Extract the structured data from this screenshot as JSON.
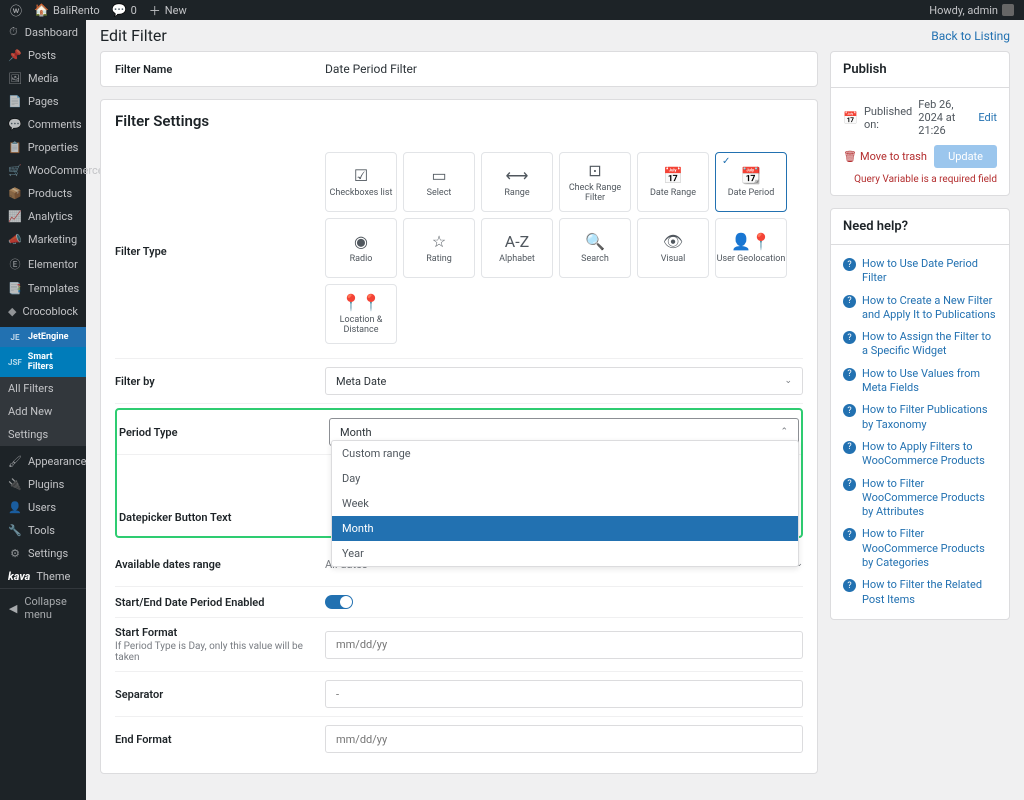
{
  "admin_bar": {
    "site_name": "BaliRento",
    "comments_count": "0",
    "new_label": "New",
    "howdy": "Howdy, admin"
  },
  "sidebar": {
    "items": [
      {
        "icon": "⏱",
        "label": "Dashboard"
      },
      {
        "icon": "📌",
        "label": "Posts"
      },
      {
        "icon": "🖼",
        "label": "Media"
      },
      {
        "icon": "📄",
        "label": "Pages"
      },
      {
        "icon": "💬",
        "label": "Comments"
      },
      {
        "icon": "📋",
        "label": "Properties"
      },
      {
        "icon": "🛒",
        "label": "WooCommerce"
      },
      {
        "icon": "📦",
        "label": "Products"
      },
      {
        "icon": "📈",
        "label": "Analytics"
      },
      {
        "icon": "📣",
        "label": "Marketing"
      },
      {
        "icon": "Ⓔ",
        "label": "Elementor"
      },
      {
        "icon": "📑",
        "label": "Templates"
      },
      {
        "icon": "◆",
        "label": "Crocoblock"
      }
    ],
    "jet_items": [
      {
        "abbr": "JE",
        "label": "JetEngine"
      },
      {
        "abbr": "JSF",
        "label": "Smart Filters"
      }
    ],
    "submenu": [
      "All Filters",
      "Add New",
      "Settings"
    ],
    "items2": [
      {
        "icon": "🖌",
        "label": "Appearance"
      },
      {
        "icon": "🔌",
        "label": "Plugins"
      },
      {
        "icon": "👤",
        "label": "Users"
      },
      {
        "icon": "🔧",
        "label": "Tools"
      },
      {
        "icon": "⚙",
        "label": "Settings"
      }
    ],
    "theme_label": "Theme",
    "collapse": "Collapse menu"
  },
  "header": {
    "title": "Edit Filter",
    "back": "Back to Listing"
  },
  "filter_name": {
    "label": "Filter Name",
    "value": "Date Period Filter"
  },
  "settings": {
    "title": "Filter Settings",
    "type_label": "Filter Type",
    "types": [
      {
        "icon": "☑",
        "label": "Checkboxes list"
      },
      {
        "icon": "▭",
        "label": "Select"
      },
      {
        "icon": "⟷",
        "label": "Range"
      },
      {
        "icon": "⊡",
        "label": "Check Range Filter"
      },
      {
        "icon": "📅",
        "label": "Date Range"
      },
      {
        "icon": "📆",
        "label": "Date Period",
        "selected": true
      },
      {
        "icon": "◉",
        "label": "Radio"
      },
      {
        "icon": "☆",
        "label": "Rating"
      },
      {
        "icon": "A-Z",
        "label": "Alphabet"
      },
      {
        "icon": "🔍",
        "label": "Search"
      },
      {
        "icon": "👁",
        "label": "Visual"
      },
      {
        "icon": "👤📍",
        "label": "User Geolocation"
      },
      {
        "icon": "📍📍",
        "label": "Location & Distance"
      }
    ],
    "filter_by": {
      "label": "Filter by",
      "value": "Meta Date"
    },
    "period_type": {
      "label": "Period Type",
      "value": "Month",
      "options": [
        "Custom range",
        "Day",
        "Week",
        "Month",
        "Year"
      ]
    },
    "datepicker_label": "Datepicker Button Text",
    "available_dates": {
      "label": "Available dates range",
      "value": "All dates"
    },
    "start_end_enabled": "Start/End Date Period Enabled",
    "start_format": {
      "label": "Start Format",
      "placeholder": "mm/dd/yy",
      "sub": "If Period Type is Day, only this value will be taken"
    },
    "separator": {
      "label": "Separator",
      "placeholder": "-"
    },
    "end_format": {
      "label": "End Format",
      "placeholder": "mm/dd/yy"
    }
  },
  "publish": {
    "title": "Publish",
    "published_on": "Published on:",
    "date": "Feb 26, 2024 at 21:26",
    "edit": "Edit",
    "trash": "Move to trash",
    "update": "Update",
    "note": "Query Variable is a required field"
  },
  "help": {
    "title": "Need help?",
    "links": [
      "How to Use Date Period Filter",
      "How to Create a New Filter and Apply It to Publications",
      "How to Assign the Filter to a Specific Widget",
      "How to Use Values from Meta Fields",
      "How to Filter Publications by Taxonomy",
      "How to Apply Filters to WooCommerce Products",
      "How to Filter WooCommerce Products by Attributes",
      "How to Filter WooCommerce Products by Categories",
      "How to Filter the Related Post Items"
    ]
  }
}
